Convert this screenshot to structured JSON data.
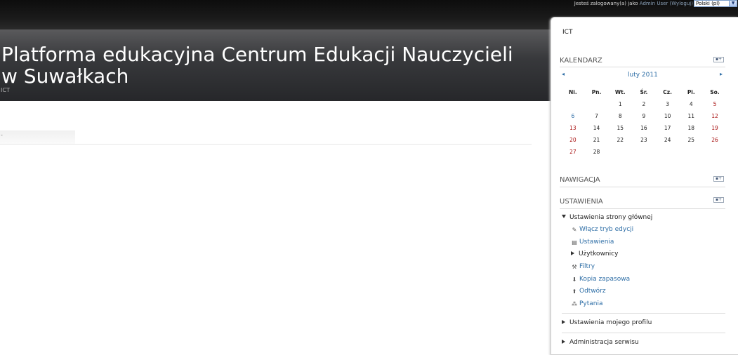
{
  "topbar": {
    "login_prefix": "Jesteś zalogowany(a) jako",
    "user": "Admin User",
    "logout": "(Wyloguj)",
    "language": "Polski (pl)"
  },
  "header": {
    "title": "Platforma edukacyjna Centrum Edukacji Nauczycieli w Suwałkach",
    "shortname": "ICT"
  },
  "sidebar": {
    "course_label": "ICT",
    "calendar": {
      "heading": "KALENDARZ",
      "month": "luty 2011",
      "days": [
        "Ni.",
        "Pn.",
        "Wt.",
        "Śr.",
        "Cz.",
        "Pi.",
        "So."
      ],
      "weeks": [
        [
          "",
          "",
          "1",
          "2",
          "3",
          "4",
          "5"
        ],
        [
          "6",
          "7",
          "8",
          "9",
          "10",
          "11",
          "12"
        ],
        [
          "13",
          "14",
          "15",
          "16",
          "17",
          "18",
          "19"
        ],
        [
          "20",
          "21",
          "22",
          "23",
          "24",
          "25",
          "26"
        ],
        [
          "27",
          "28",
          "",
          "",
          "",
          "",
          ""
        ]
      ]
    },
    "navigation": {
      "heading": "NAWIGACJA"
    },
    "settings": {
      "heading": "USTAWIENIA",
      "front_page": "Ustawienia strony głównej",
      "items": [
        {
          "label": "Włącz tryb edycji",
          "icon": "pencil-icon"
        },
        {
          "label": "Ustawienia",
          "icon": "settings-doc-icon"
        },
        {
          "label": "Użytkownicy",
          "icon": "expand-icon"
        },
        {
          "label": "Filtry",
          "icon": "filter-icon"
        },
        {
          "label": "Kopia zapasowa",
          "icon": "backup-icon"
        },
        {
          "label": "Odtwórz",
          "icon": "restore-icon"
        },
        {
          "label": "Pytania",
          "icon": "questions-icon"
        }
      ],
      "my_profile": "Ustawienia mojego profilu",
      "site_admin": "Administracja serwisu"
    }
  }
}
